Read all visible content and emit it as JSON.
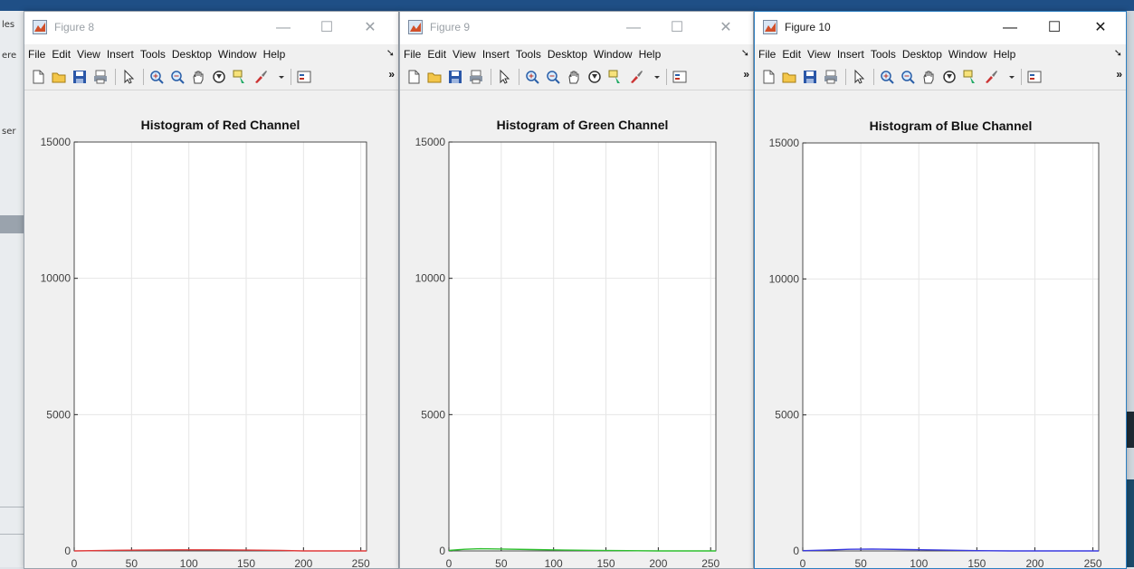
{
  "menu_items": [
    "File",
    "Edit",
    "View",
    "Insert",
    "Tools",
    "Desktop",
    "Window",
    "Help"
  ],
  "background": {
    "left_texts": [
      "les",
      "ere",
      "ser"
    ]
  },
  "windows": [
    {
      "title": "Figure 8",
      "active": false,
      "plot_title": "Histogram of Red Channel",
      "line_color": "#e03a3a"
    },
    {
      "title": "Figure 9",
      "active": false,
      "plot_title": "Histogram of Green Channel",
      "line_color": "#2fbf2f"
    },
    {
      "title": "Figure 10",
      "active": true,
      "plot_title": "Histogram of Blue Channel",
      "line_color": "#3a3ae0"
    }
  ],
  "chart_data": [
    {
      "type": "line",
      "title": "Histogram of Red Channel",
      "xlabel": "",
      "ylabel": "",
      "xlim": [
        0,
        255
      ],
      "ylim": [
        0,
        15000
      ],
      "xticks": [
        0,
        50,
        100,
        150,
        200,
        250
      ],
      "yticks": [
        0,
        5000,
        10000,
        15000
      ],
      "grid": true,
      "series": [
        {
          "color": "#e03a3a",
          "x": [
            0,
            30,
            60,
            90,
            120,
            150,
            180,
            200,
            255
          ],
          "y": [
            0,
            20,
            30,
            40,
            40,
            30,
            20,
            0,
            0
          ]
        }
      ]
    },
    {
      "type": "line",
      "title": "Histogram of Green Channel",
      "xlabel": "",
      "ylabel": "",
      "xlim": [
        0,
        255
      ],
      "ylim": [
        0,
        15000
      ],
      "xticks": [
        0,
        50,
        100,
        150,
        200,
        250
      ],
      "yticks": [
        0,
        5000,
        10000,
        15000
      ],
      "grid": true,
      "series": [
        {
          "color": "#2fbf2f",
          "x": [
            0,
            15,
            30,
            50,
            80,
            110,
            140,
            170,
            200,
            255
          ],
          "y": [
            20,
            60,
            80,
            70,
            50,
            30,
            20,
            10,
            0,
            0
          ]
        }
      ]
    },
    {
      "type": "line",
      "title": "Histogram of Blue Channel",
      "xlabel": "",
      "ylabel": "",
      "xlim": [
        0,
        255
      ],
      "ylim": [
        0,
        15000
      ],
      "xticks": [
        0,
        50,
        100,
        150,
        200,
        250
      ],
      "yticks": [
        0,
        5000,
        10000,
        15000
      ],
      "grid": true,
      "series": [
        {
          "color": "#3a3ae0",
          "x": [
            0,
            20,
            40,
            60,
            90,
            120,
            150,
            180,
            255
          ],
          "y": [
            10,
            30,
            60,
            70,
            50,
            30,
            10,
            0,
            0
          ]
        }
      ]
    }
  ]
}
